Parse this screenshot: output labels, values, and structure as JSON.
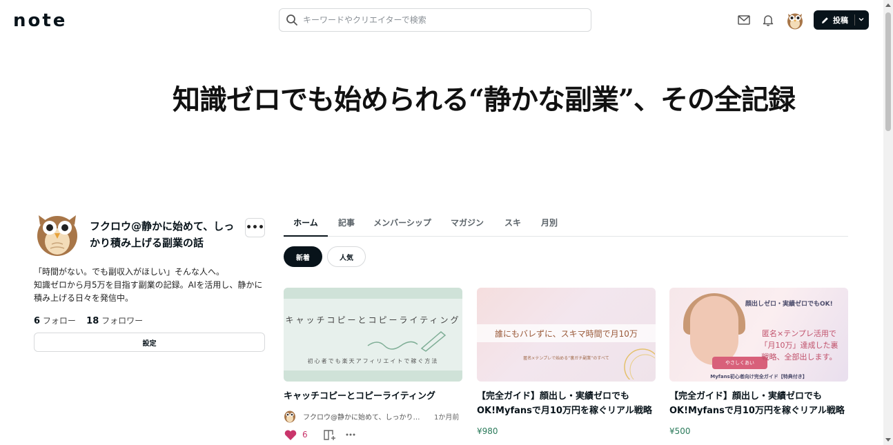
{
  "header": {
    "logo": "note",
    "search_placeholder": "キーワードやクリエイターで検索",
    "post_label": "投稿"
  },
  "banner": {
    "title": "知識ゼロでも始められる“静かな副業”、その全記録"
  },
  "profile": {
    "name": "フクロウ@静かに始めて、しっかり積み上げる副業の話",
    "more": "•••",
    "bio": [
      "「時間がない。でも副収入がほしい」そんな人へ。",
      "知識ゼロから月5万を目指す副業の記録。AIを活用し、静かに積み上げる日々を発信中。"
    ],
    "follow_count": "6",
    "follow_label": "フォロー",
    "follower_count": "18",
    "follower_label": "フォロワー",
    "settings_label": "設定"
  },
  "tabs": [
    "ホーム",
    "記事",
    "メンバーシップ",
    "マガジン",
    "スキ",
    "月別"
  ],
  "filters": {
    "new": "新着",
    "popular": "人気"
  },
  "cards": [
    {
      "title": "キャッチコピーとコピーライティング",
      "thumb_text_1": "キャッチコピーとコピーライティング",
      "thumb_text_2": "初心者でも楽天アフィリエイトで稼ぐ方法",
      "author": "フクロウ@静かに始めて、しっかり…",
      "time": "1か月前",
      "likes": "6"
    },
    {
      "title": "【完全ガイド】顔出し・実績ゼロでもOK!Myfansで月10万円を稼ぐリアル戦略",
      "thumb_text_1": "誰にもバレずに、スキマ時間で月10万",
      "thumb_text_2": "匿名×テンプレで始める“裏ガチ副業”のすべて",
      "price": "¥980"
    },
    {
      "title": "【完全ガイド】顔出し・実績ゼロでもOK!Myfansで月10万円を稼ぐリアル戦略",
      "thumb_text_1": "顔出しゼロ・実績ゼロでもOK!",
      "thumb_text_2": "匿名×テンプレ活用で「月10万」達成した裏戦略、全部出します。",
      "thumb_text_3": "Myfans初心者向け完全ガイド【特典付き】",
      "thumb_ribbon": "やさしくあい",
      "price": "¥500"
    }
  ],
  "colors": {
    "primary": "#08131a",
    "like": "#c9356b",
    "price": "#2a7a5a"
  }
}
